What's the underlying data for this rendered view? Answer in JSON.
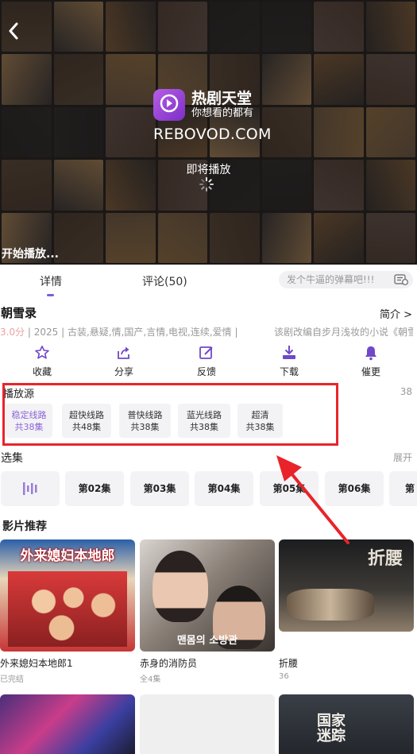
{
  "player": {
    "brand_name": "热剧天堂",
    "brand_slogan": "你想看的都有",
    "brand_domain": "REBOVOD.COM",
    "logo_caption": "热剧天堂",
    "loading_text": "即将播放",
    "start_text": "开始播放..."
  },
  "tabs": [
    {
      "label": "详情",
      "active": true
    },
    {
      "label": "评论(50)",
      "active": false
    }
  ],
  "danmaku": {
    "placeholder": "发个牛逼的弹幕吧!!!"
  },
  "show": {
    "title": "朝雪录",
    "intro_link": "简介 >",
    "score": "3.0分",
    "meta": " | 2025 | 古装,悬疑,情,国产,言情,电视,连续,爱情 | ",
    "description": "该剧改编自步月浅妆的小说《朝雪录》"
  },
  "actions": [
    {
      "label": "收藏",
      "icon": "star-icon"
    },
    {
      "label": "分享",
      "icon": "share-icon"
    },
    {
      "label": "反馈",
      "icon": "edit-icon"
    },
    {
      "label": "下载",
      "icon": "download-icon"
    },
    {
      "label": "催更",
      "icon": "bell-icon"
    }
  ],
  "sources": {
    "title": "播放源",
    "count": "38",
    "items": [
      {
        "name": "稳定线路",
        "episodes": "共38集",
        "active": true
      },
      {
        "name": "超快线路",
        "episodes": "共48集",
        "active": false
      },
      {
        "name": "普快线路",
        "episodes": "共38集",
        "active": false
      },
      {
        "name": "蓝光线路",
        "episodes": "共38集",
        "active": false
      },
      {
        "name": "超清",
        "episodes": "共38集",
        "active": false
      }
    ]
  },
  "episodes": {
    "title": "选集",
    "expand": "展开",
    "items": [
      "第02集",
      "第03集",
      "第04集",
      "第05集",
      "第06集",
      "第0"
    ]
  },
  "recommend": {
    "title": "影片推荐",
    "items": [
      {
        "name": "外来媳妇本地郎1",
        "sub": "已完结",
        "poster_text": "外来媳妇本地郎"
      },
      {
        "name": "赤身的消防员",
        "sub": "全4集",
        "poster_text": "맨몸의 소방관"
      },
      {
        "name": "折腰",
        "sub": "36",
        "poster_text": "折腰"
      }
    ],
    "second_row": [
      {
        "poster_text": ""
      },
      {
        "poster_text": ""
      },
      {
        "poster_text": "国家迷踪"
      }
    ]
  },
  "colors": {
    "accent": "#8c64d8",
    "highlight": "#e8242a"
  }
}
